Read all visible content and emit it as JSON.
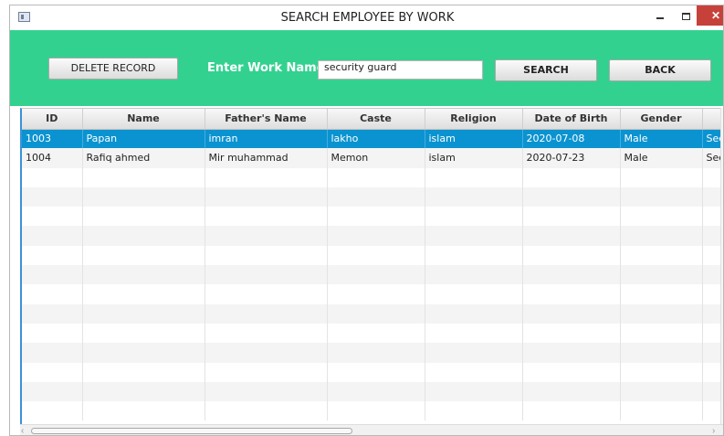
{
  "window": {
    "title": "SEARCH EMPLOYEE BY WORK",
    "min_label": "",
    "close_label": "✕"
  },
  "toolbar": {
    "delete_label": "DELETE RECORD",
    "work_label": "Enter Work Name:",
    "work_value": "security guard",
    "search_label": "SEARCH",
    "back_label": "BACK"
  },
  "table": {
    "columns": [
      "ID",
      "Name",
      "Father's Name",
      "Caste",
      "Religion",
      "Date of Birth",
      "Gender",
      ""
    ],
    "rows": [
      [
        "1003",
        "Papan",
        "imran",
        "lakho",
        "islam",
        "2020-07-08",
        "Male",
        "Sec"
      ],
      [
        "1004",
        "Rafiq ahmed",
        "Mir muhammad",
        "Memon",
        "islam",
        "2020-07-23",
        "Male",
        "Sec"
      ]
    ],
    "selected_row": 0
  },
  "colors": {
    "accent": "#33d18f",
    "selection": "#0a93d0",
    "close": "#c7413b"
  },
  "scroll": {
    "left_arrow": "‹",
    "right_arrow": "›"
  }
}
